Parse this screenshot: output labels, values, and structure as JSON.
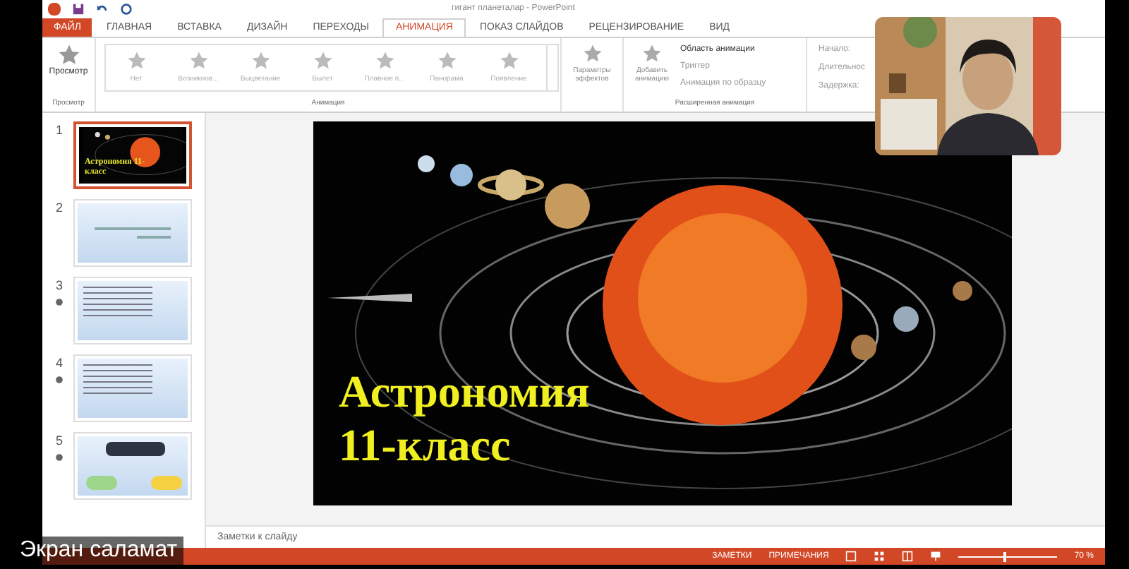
{
  "window": {
    "title": "гигант планеталар - PowerPoint"
  },
  "tabs": [
    {
      "label": "ФАЙЛ",
      "kind": "file",
      "selected": false
    },
    {
      "label": "ГЛАВНАЯ",
      "kind": "tab",
      "selected": false
    },
    {
      "label": "ВСТАВКА",
      "kind": "tab",
      "selected": false
    },
    {
      "label": "ДИЗАЙН",
      "kind": "tab",
      "selected": false
    },
    {
      "label": "ПЕРЕХОДЫ",
      "kind": "tab",
      "selected": false
    },
    {
      "label": "АНИМАЦИЯ",
      "kind": "tab",
      "selected": true
    },
    {
      "label": "ПОКАЗ СЛАЙДОВ",
      "kind": "tab",
      "selected": false
    },
    {
      "label": "РЕЦЕНЗИРОВАНИЕ",
      "kind": "tab",
      "selected": false
    },
    {
      "label": "ВИД",
      "kind": "tab",
      "selected": false
    }
  ],
  "ribbon": {
    "preview": {
      "label": "Просмотр",
      "group": "Просмотр"
    },
    "gallery": {
      "group": "Анимация",
      "items": [
        "Нет",
        "Возникнов...",
        "Выцветание",
        "Вылет",
        "Плавное п...",
        "Панорама",
        "Появление"
      ]
    },
    "effects": {
      "label": "Параметры эффектов"
    },
    "add": {
      "label": "Добавить анимацию"
    },
    "advanced": {
      "group": "Расширенная анимация",
      "items": [
        "Область анимации",
        "Триггер",
        "Анимация по образцу"
      ]
    },
    "timing": [
      "Начало:",
      "Длительнос",
      "Задержка:"
    ]
  },
  "slides": [
    {
      "number": "1",
      "selected": true,
      "animated": false,
      "kind": "title",
      "text": "Астрономия 11-класс"
    },
    {
      "number": "2",
      "selected": false,
      "animated": false,
      "kind": "text"
    },
    {
      "number": "3",
      "selected": false,
      "animated": true,
      "kind": "list"
    },
    {
      "number": "4",
      "selected": false,
      "animated": true,
      "kind": "list"
    },
    {
      "number": "5",
      "selected": false,
      "animated": true,
      "kind": "diagram"
    }
  ],
  "slide": {
    "title": "Астрономия",
    "subtitle": "11-класс"
  },
  "notes": {
    "placeholder": "Заметки к слайду"
  },
  "status_bar": {
    "notes": "ЗАМЕТКИ",
    "comments": "ПРИМЕЧАНИЯ",
    "zoom": "70 %",
    "level": 0.45
  },
  "caption": "Экран саламат"
}
